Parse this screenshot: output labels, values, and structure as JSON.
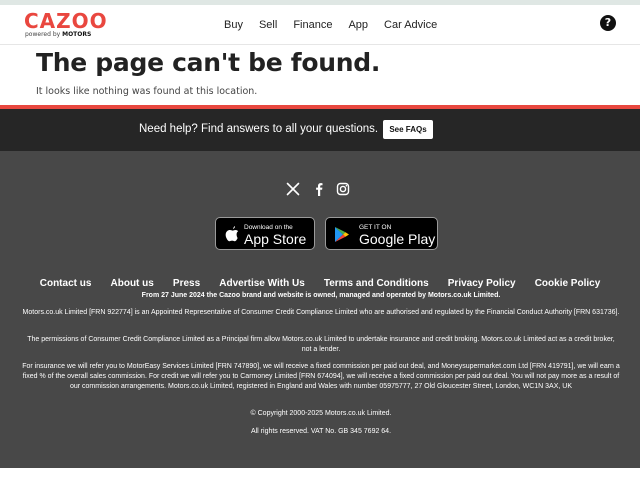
{
  "header": {
    "logo": {
      "word": "CAZOO",
      "sub_prefix": "powered by",
      "sub_brand": "MOTORS"
    },
    "nav": [
      "Buy",
      "Sell",
      "Finance",
      "App",
      "Car Advice"
    ],
    "help_icon": "question-circle-icon"
  },
  "hero": {
    "title": "The page can't be found.",
    "subtitle": "It looks like nothing was found at this location."
  },
  "helpbar": {
    "text": "Need help? Find answers to all your questions.",
    "button": "See FAQs"
  },
  "footer": {
    "social_icons": [
      "x-twitter-icon",
      "facebook-icon",
      "instagram-icon"
    ],
    "app_store": {
      "small": "Download on the",
      "big": "App Store"
    },
    "google_play": {
      "small": "GET IT ON",
      "big": "Google Play"
    },
    "links": [
      "Contact us",
      "About us",
      "Press",
      "Advertise With Us",
      "Terms and Conditions",
      "Privacy Policy",
      "Cookie Policy"
    ],
    "notice": "From 27 June 2024 the Cazoo brand and website is owned, managed and operated by Motors.co.uk Limited.",
    "paragraphs": [
      "Motors.co.uk Limited [FRN 922774] is an Appointed Representative of Consumer Credit Compliance Limited who are authorised and regulated by the Financial Conduct Authority [FRN 631736].",
      "The permissions of Consumer Credit Compliance Limited as a Principal firm allow Motors.co.uk Limited to undertake insurance and credit broking. Motors.co.uk Limited act as a credit broker, not a lender.",
      "For insurance we will refer you to MotorEasy Services Limited [FRN 747890], we will receive a fixed commission per paid out deal, and Moneysupermarket.com Ltd [FRN 419791], we will earn a fixed % of the overall sales commission. For credit we will refer you to Carmoney Limited [FRN 674094], we will receive a fixed commission per paid out deal. You will not pay more as a result of our commission arrangements. Motors.co.uk Limited, registered in England and Wales with number 05975777, 27 Old Gloucester Street, London, WC1N 3AX, UK"
    ],
    "copyright": "© Copyright 2000-2025 Motors.co.uk Limited.",
    "rights": "All rights reserved. VAT No. GB 345 7692 64."
  },
  "colors": {
    "brand_red": "#e9473f",
    "helpbar_bg": "#262626",
    "footer_bg": "#484848"
  }
}
